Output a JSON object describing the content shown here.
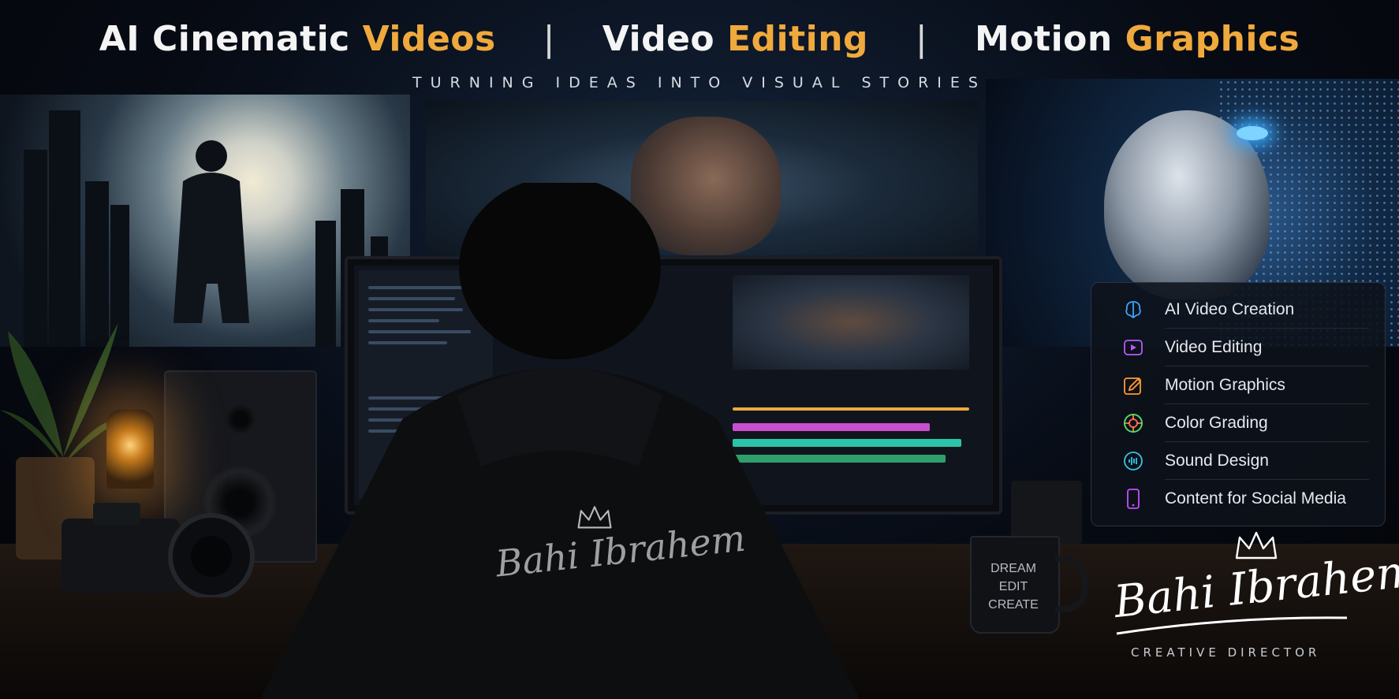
{
  "headline": {
    "part1_white": "AI Cinematic",
    "part1_gold": "Videos",
    "separator": "|",
    "part2_white": "Video",
    "part2_gold": "Editing",
    "part3_white": "Motion",
    "part3_gold": "Graphics"
  },
  "tagline": "TURNING IDEAS INTO VISUAL STORIES",
  "services": [
    {
      "label": "AI Video Creation",
      "icon": "brain-icon",
      "color": "#3aa4ff"
    },
    {
      "label": "Video Editing",
      "icon": "play-icon",
      "color": "#b25cff"
    },
    {
      "label": "Motion Graphics",
      "icon": "pen-icon",
      "color": "#ff9a2e"
    },
    {
      "label": "Color Grading",
      "icon": "color-wheel-icon",
      "color": "#53d46a"
    },
    {
      "label": "Sound Design",
      "icon": "sound-wave-icon",
      "color": "#36c6e6"
    },
    {
      "label": "Content for Social Media",
      "icon": "phone-icon",
      "color": "#c84cff"
    }
  ],
  "mug": {
    "line1": "DREAM",
    "line2": "EDIT",
    "line3": "CREATE"
  },
  "hoodie_signature": "Bahi Ibrahem",
  "signature": {
    "name": "Bahi Ibrahem",
    "title": "CREATIVE DIRECTOR"
  },
  "colors": {
    "accent_gold": "#f0a93c",
    "background": "#05070c"
  }
}
